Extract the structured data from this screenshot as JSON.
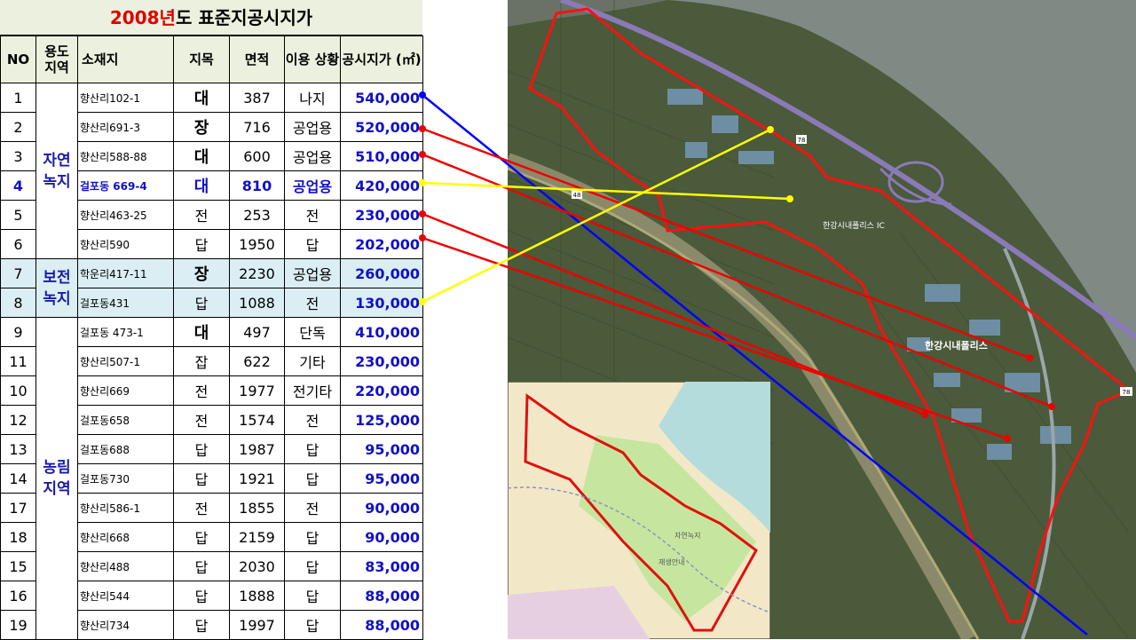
{
  "title": {
    "year": "2008년",
    "rest": "도 표준지공시지가"
  },
  "headers": {
    "no": "NO",
    "zone": "용도 지역",
    "address": "소재지",
    "category": "지목",
    "area": "면적",
    "usage": "이용 상황",
    "price": "공시지가 (㎡)"
  },
  "zones": {
    "natural_green": "자연 녹지",
    "preserved_green": "보전 녹지",
    "agricultural": "농림 지역"
  },
  "rows": [
    {
      "no": "1",
      "address": "향산리102-1",
      "category": "대",
      "area": "387",
      "usage": "나지",
      "price": "540,000"
    },
    {
      "no": "2",
      "address": "향산리691-3",
      "category": "장",
      "area": "716",
      "usage": "공업용",
      "price": "520,000"
    },
    {
      "no": "3",
      "address": "향산리588-88",
      "category": "대",
      "area": "600",
      "usage": "공업용",
      "price": "510,000"
    },
    {
      "no": "4",
      "address": "걸포동 669-4",
      "category": "대",
      "area": "810",
      "usage": "공업용",
      "price": "420,000"
    },
    {
      "no": "5",
      "address": "향산리463-25",
      "category": "전",
      "area": "253",
      "usage": "전",
      "price": "230,000"
    },
    {
      "no": "6",
      "address": "향산리590",
      "category": "답",
      "area": "1950",
      "usage": "답",
      "price": "202,000"
    },
    {
      "no": "7",
      "address": "학운리417-11",
      "category": "장",
      "area": "2230",
      "usage": "공업용",
      "price": "260,000"
    },
    {
      "no": "8",
      "address": "걸포동431",
      "category": "답",
      "area": "1088",
      "usage": "전",
      "price": "130,000"
    },
    {
      "no": "9",
      "address": "걸포동 473-1",
      "category": "대",
      "area": "497",
      "usage": "단독",
      "price": "410,000"
    },
    {
      "no": "11",
      "address": "향산리507-1",
      "category": "잡",
      "area": "622",
      "usage": "기타",
      "price": "230,000"
    },
    {
      "no": "10",
      "address": "향산리669",
      "category": "전",
      "area": "1977",
      "usage": "전기타",
      "price": "220,000"
    },
    {
      "no": "12",
      "address": "걸포동658",
      "category": "전",
      "area": "1574",
      "usage": "전",
      "price": "125,000"
    },
    {
      "no": "13",
      "address": "걸포동688",
      "category": "답",
      "area": "1987",
      "usage": "답",
      "price": "95,000"
    },
    {
      "no": "14",
      "address": "걸포동730",
      "category": "답",
      "area": "1921",
      "usage": "답",
      "price": "95,000"
    },
    {
      "no": "17",
      "address": "향산리586-1",
      "category": "전",
      "area": "1855",
      "usage": "전",
      "price": "90,000"
    },
    {
      "no": "18",
      "address": "향산리668",
      "category": "답",
      "area": "2159",
      "usage": "답",
      "price": "90,000"
    },
    {
      "no": "15",
      "address": "향산리488",
      "category": "답",
      "area": "2030",
      "usage": "답",
      "price": "83,000"
    },
    {
      "no": "16",
      "address": "향산리544",
      "category": "답",
      "area": "1888",
      "usage": "답",
      "price": "88,000"
    },
    {
      "no": "19",
      "address": "향산리734",
      "category": "답",
      "area": "1997",
      "usage": "답",
      "price": "88,000"
    }
  ],
  "map": {
    "road_78": "78",
    "road_48": "48",
    "ic_label": "한강시내폴리스 IC",
    "site_label": "한강시내폴리스",
    "inset_label_1": "자연녹지",
    "inset_label_2": "재생안내"
  },
  "colors": {
    "boundary": "#ff1010",
    "link_blue": "#0000ff",
    "link_red": "#ee0000",
    "link_yellow": "#ffff00",
    "price_text": "#1010c8",
    "title_year": "#e00000"
  }
}
